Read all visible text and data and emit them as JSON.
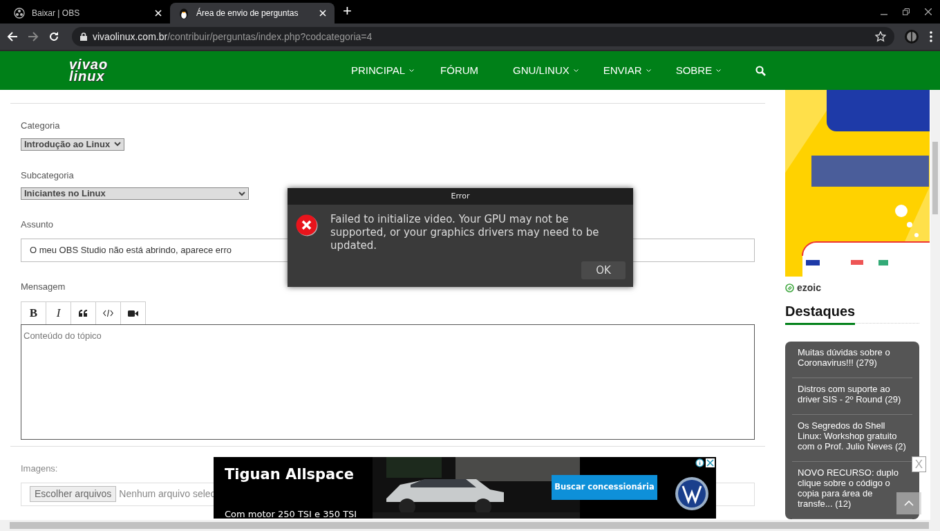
{
  "browser": {
    "tabs": [
      {
        "title": "Baixar | OBS",
        "selected": false
      },
      {
        "title": "Área de envio de perguntas",
        "selected": true
      }
    ],
    "new_tab": "+",
    "url": {
      "host": "vivaolinux.com.br",
      "path": "/contribuir/perguntas/index.php?codcategoria=4"
    }
  },
  "site": {
    "logo": [
      "vivao",
      "linux"
    ],
    "nav": [
      {
        "label": "PRINCIPAL",
        "dropdown": true
      },
      {
        "label": "FÓRUM",
        "dropdown": false
      },
      {
        "label": "GNU/LINUX",
        "dropdown": true
      },
      {
        "label": "ENVIAR",
        "dropdown": true
      },
      {
        "label": "SOBRE",
        "dropdown": true
      }
    ]
  },
  "form": {
    "category": {
      "label": "Categoria",
      "value": "Introdução ao Linux"
    },
    "subcategory": {
      "label": "Subcategoria",
      "value": "Iniciantes no Linux"
    },
    "subject": {
      "label": "Assunto",
      "value": "O meu OBS Studio não está abrindo, aparece erro"
    },
    "message": {
      "label": "Mensagem",
      "placeholder": "Conteúdo do tópico",
      "toolbar": [
        {
          "kind": "bold",
          "label": "B"
        },
        {
          "kind": "italic",
          "label": "I"
        },
        {
          "kind": "quote"
        },
        {
          "kind": "code"
        },
        {
          "kind": "video"
        }
      ]
    },
    "images": {
      "label": "Imagens:",
      "button": "Escolher arquivos",
      "status": "Nenhum arquivo selec"
    }
  },
  "sidebar": {
    "ad_network": "ezoic",
    "heading": "Destaques",
    "highlights": [
      "Muitas dúvidas sobre o Coronavirus!!! (279)",
      "Distros com suporte ao driver SIS - 2º Round (29)",
      "Os Segredos do Shell Linux: Workshop gratuito com o Prof. Julio Neves (2)",
      "NOVO RECURSO: duplo clique sobre o código o copia para área de transfe... (12)"
    ]
  },
  "dialog": {
    "title": "Error",
    "message": "Failed to initialize video.  Your GPU may not be supported, or your graphics drivers may need to be updated.",
    "button": "OK"
  },
  "ad": {
    "headline": "Tiguan Allspace",
    "subline": "Com motor 250 TSI e 350 TSI",
    "button": "Buscar concessionária",
    "close": "X"
  }
}
